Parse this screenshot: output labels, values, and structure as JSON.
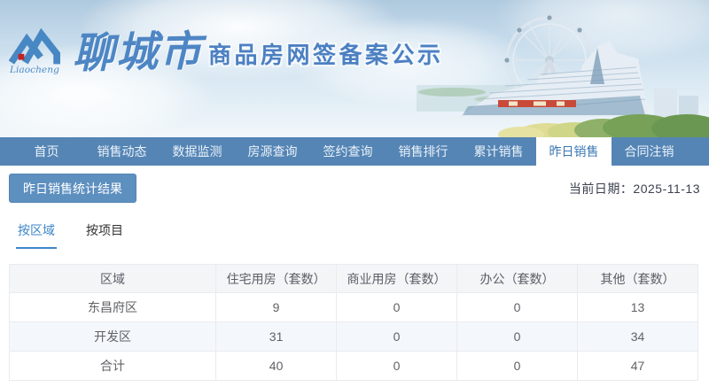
{
  "header": {
    "logo_text": "Liaocheng",
    "title_script": "聊城市",
    "title_main": "商品房网签备案公示"
  },
  "nav": {
    "items": [
      {
        "label": "首页",
        "active": false
      },
      {
        "label": "销售动态",
        "active": false
      },
      {
        "label": "数据监测",
        "active": false
      },
      {
        "label": "房源查询",
        "active": false
      },
      {
        "label": "签约查询",
        "active": false
      },
      {
        "label": "销售排行",
        "active": false
      },
      {
        "label": "累计销售",
        "active": false
      },
      {
        "label": "昨日销售",
        "active": true
      },
      {
        "label": "合同注销",
        "active": false
      }
    ]
  },
  "toolbar": {
    "result_button_label": "昨日销售统计结果",
    "current_date_label": "当前日期：",
    "current_date_value": "2025-11-13"
  },
  "tabs": [
    {
      "label": "按区域",
      "active": true
    },
    {
      "label": "按项目",
      "active": false
    }
  ],
  "table": {
    "columns": [
      "区域",
      "住宅用房（套数）",
      "商业用房（套数）",
      "办公（套数）",
      "其他（套数）"
    ],
    "rows": [
      [
        "东昌府区",
        "9",
        "0",
        "0",
        "13"
      ],
      [
        "开发区",
        "31",
        "0",
        "0",
        "34"
      ],
      [
        "合计",
        "40",
        "0",
        "0",
        "47"
      ]
    ]
  },
  "colors": {
    "nav_background": "#5585b5",
    "active_tab_text": "#3a78b4",
    "accent_blue": "#3e86c8",
    "button_background": "#5d8fbf",
    "title_blue": "#4c80c2",
    "stripe_row": "#f4f8fc",
    "table_header_bg": "#f4f5f7"
  }
}
